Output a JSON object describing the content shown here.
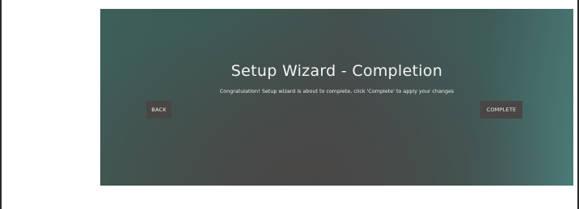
{
  "wizard": {
    "title": "Setup Wizard - Completion",
    "message": "Congratulation! Setup wizard is about to complete, click 'Complete' to apply your changes",
    "back_label": "BACK",
    "complete_label": "COMPLETE"
  }
}
